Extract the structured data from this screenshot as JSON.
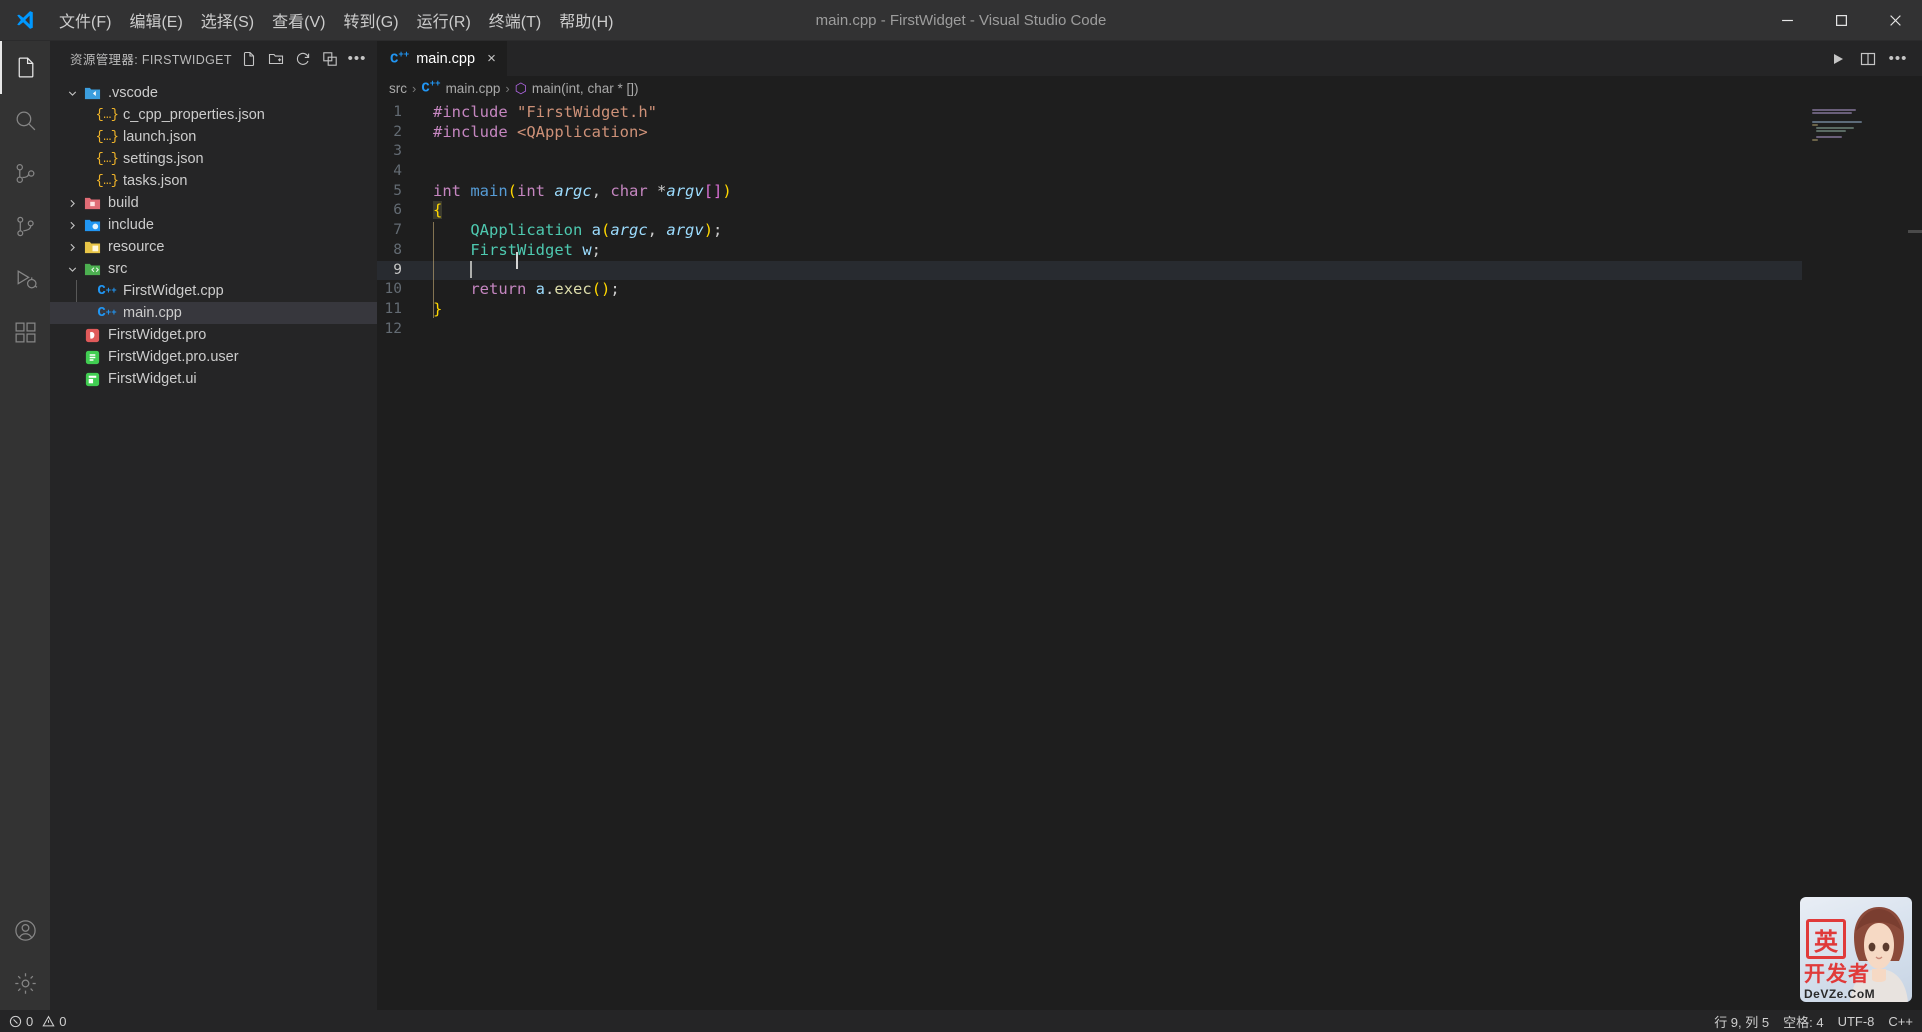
{
  "window": {
    "title": "main.cpp - FirstWidget - Visual Studio Code",
    "minimize_label": "最小化",
    "maximize_label": "最大化",
    "close_label": "关闭"
  },
  "menu": {
    "items": [
      {
        "label": "文件(F)",
        "name": "menu-file"
      },
      {
        "label": "编辑(E)",
        "name": "menu-edit"
      },
      {
        "label": "选择(S)",
        "name": "menu-selection"
      },
      {
        "label": "查看(V)",
        "name": "menu-view"
      },
      {
        "label": "转到(G)",
        "name": "menu-go"
      },
      {
        "label": "运行(R)",
        "name": "menu-run"
      },
      {
        "label": "终端(T)",
        "name": "menu-terminal"
      },
      {
        "label": "帮助(H)",
        "name": "menu-help"
      }
    ]
  },
  "activitybar": {
    "items": [
      {
        "name": "explorer",
        "icon": "files-icon",
        "active": true
      },
      {
        "name": "search",
        "icon": "search-icon",
        "active": false
      },
      {
        "name": "source-control",
        "icon": "source-control-icon",
        "active": false
      },
      {
        "name": "git",
        "icon": "git-branch-icon",
        "active": false
      },
      {
        "name": "run-debug",
        "icon": "run-debug-icon",
        "active": false
      },
      {
        "name": "extensions",
        "icon": "extensions-icon",
        "active": false
      }
    ],
    "bottom": [
      {
        "name": "accounts",
        "icon": "account-icon"
      },
      {
        "name": "manage",
        "icon": "gear-icon"
      }
    ]
  },
  "sidebar": {
    "title": "资源管理器: FIRSTWIDGET",
    "actions": [
      {
        "name": "new-file-button",
        "icon": "new-file-icon"
      },
      {
        "name": "new-folder-button",
        "icon": "new-folder-icon"
      },
      {
        "name": "refresh-button",
        "icon": "refresh-icon"
      },
      {
        "name": "collapse-all-button",
        "icon": "collapse-all-icon"
      },
      {
        "name": "views-and-more-button",
        "icon": "ellipsis-icon"
      }
    ],
    "tree": [
      {
        "label": ".vscode",
        "type": "folder",
        "icon": "folder-vscode-icon",
        "expanded": true,
        "depth": 0,
        "color": "#3c9ede"
      },
      {
        "label": "c_cpp_properties.json",
        "type": "json",
        "icon": "json-icon",
        "depth": 1
      },
      {
        "label": "launch.json",
        "type": "json",
        "icon": "json-icon",
        "depth": 1
      },
      {
        "label": "settings.json",
        "type": "json",
        "icon": "json-icon",
        "depth": 1
      },
      {
        "label": "tasks.json",
        "type": "json",
        "icon": "json-icon",
        "depth": 1
      },
      {
        "label": "build",
        "type": "folder",
        "icon": "folder-build-icon",
        "expanded": false,
        "depth": 0,
        "color": "#e06c75"
      },
      {
        "label": "include",
        "type": "folder",
        "icon": "folder-include-icon",
        "expanded": false,
        "depth": 0,
        "color": "#2196f3"
      },
      {
        "label": "resource",
        "type": "folder",
        "icon": "folder-resource-icon",
        "expanded": false,
        "depth": 0,
        "color": "#e8c547"
      },
      {
        "label": "src",
        "type": "folder",
        "icon": "folder-src-icon",
        "expanded": true,
        "depth": 0,
        "color": "#4caf50"
      },
      {
        "label": "FirstWidget.cpp",
        "type": "cpp",
        "icon": "cpp-icon",
        "depth": 1
      },
      {
        "label": "main.cpp",
        "type": "cpp",
        "icon": "cpp-icon",
        "depth": 1,
        "selected": true
      },
      {
        "label": "FirstWidget.pro",
        "type": "pro",
        "icon": "qt-pro-icon",
        "depth": 0
      },
      {
        "label": "FirstWidget.pro.user",
        "type": "user",
        "icon": "qt-user-icon",
        "depth": 0
      },
      {
        "label": "FirstWidget.ui",
        "type": "ui",
        "icon": "qt-ui-icon",
        "depth": 0
      }
    ]
  },
  "editor": {
    "tab": {
      "label": "main.cpp",
      "icon": "cpp-icon",
      "close_label": "×",
      "active": true
    },
    "actions": [
      {
        "name": "run-button",
        "icon": "play-icon"
      },
      {
        "name": "split-editor-button",
        "icon": "split-editor-icon"
      },
      {
        "name": "more-actions-button",
        "icon": "ellipsis-icon"
      }
    ],
    "breadcrumbs": [
      {
        "label": "src",
        "icon": null
      },
      {
        "label": "main.cpp",
        "icon": "cpp-icon"
      },
      {
        "label": "main(int, char * [])",
        "icon": "symbol-method-icon"
      }
    ],
    "lines": [
      {
        "num": "1",
        "text": "#include \"FirstWidget.h\""
      },
      {
        "num": "2",
        "text": "#include <QApplication>"
      },
      {
        "num": "3",
        "text": ""
      },
      {
        "num": "4",
        "text": ""
      },
      {
        "num": "5",
        "text": "int main(int argc, char *argv[])"
      },
      {
        "num": "6",
        "text": "{"
      },
      {
        "num": "7",
        "text": "    QApplication a(argc, argv);"
      },
      {
        "num": "8",
        "text": "    FirstWidget w;"
      },
      {
        "num": "9",
        "text": "    ",
        "active": true
      },
      {
        "num": "10",
        "text": "    return a.exec();"
      },
      {
        "num": "11",
        "text": "}"
      },
      {
        "num": "12",
        "text": ""
      }
    ]
  },
  "statusbar": {
    "errors": "0",
    "warnings": "0",
    "position": "行 9, 列 5",
    "indent": "空格: 4",
    "encoding": "UTF-8",
    "language": "C++"
  },
  "watermark": {
    "stamp": "英",
    "cn": "开发者",
    "en": "DeVZe.CoM"
  },
  "colors": {
    "accent": "#007acc",
    "titlebar_bg": "#323233",
    "activitybar_bg": "#333333",
    "sidebar_bg": "#252526",
    "editor_bg": "#1e1e1e",
    "selection_bg": "#37373d",
    "text": "#cccccc"
  }
}
